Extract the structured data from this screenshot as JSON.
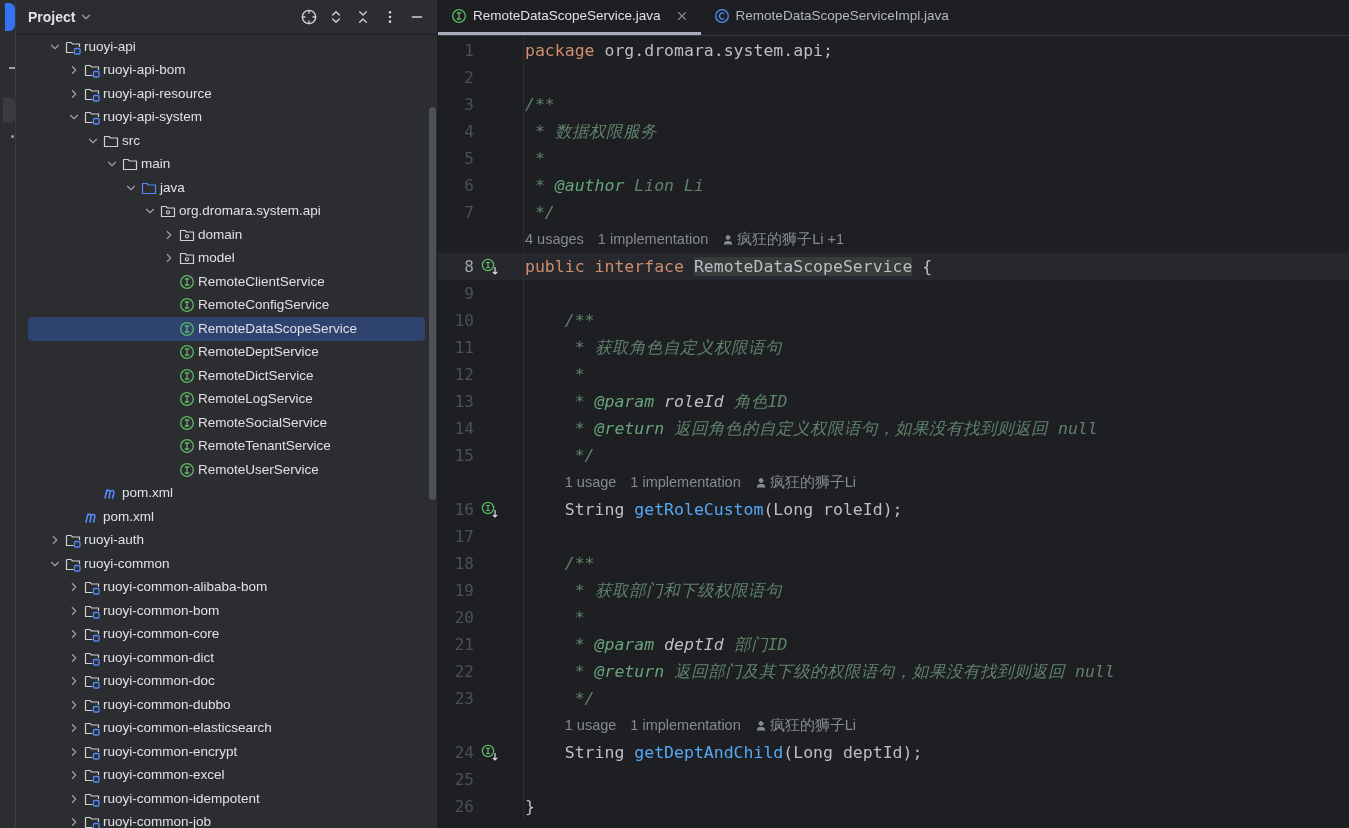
{
  "project_panel": {
    "title": "Project",
    "tree": [
      {
        "kind": "module",
        "label": "ruoyi-api",
        "expanded": true,
        "selected": false,
        "children": [
          {
            "kind": "module",
            "label": "ruoyi-api-bom",
            "expanded": false,
            "selected": false
          },
          {
            "kind": "module",
            "label": "ruoyi-api-resource",
            "expanded": false,
            "selected": false
          },
          {
            "kind": "module",
            "label": "ruoyi-api-system",
            "expanded": true,
            "selected": false,
            "children": [
              {
                "kind": "folder",
                "label": "src",
                "expanded": true,
                "selected": false,
                "children": [
                  {
                    "kind": "folder",
                    "label": "main",
                    "expanded": true,
                    "selected": false,
                    "children": [
                      {
                        "kind": "source",
                        "label": "java",
                        "expanded": true,
                        "selected": false,
                        "children": [
                          {
                            "kind": "package",
                            "label": "org.dromara.system.api",
                            "expanded": true,
                            "selected": false,
                            "children": [
                              {
                                "kind": "package",
                                "label": "domain",
                                "expanded": false,
                                "selected": false
                              },
                              {
                                "kind": "package",
                                "label": "model",
                                "expanded": false,
                                "selected": false
                              },
                              {
                                "kind": "interface",
                                "label": "RemoteClientService",
                                "selected": false
                              },
                              {
                                "kind": "interface",
                                "label": "RemoteConfigService",
                                "selected": false
                              },
                              {
                                "kind": "interface",
                                "label": "RemoteDataScopeService",
                                "selected": true
                              },
                              {
                                "kind": "interface",
                                "label": "RemoteDeptService",
                                "selected": false
                              },
                              {
                                "kind": "interface",
                                "label": "RemoteDictService",
                                "selected": false
                              },
                              {
                                "kind": "interface",
                                "label": "RemoteLogService",
                                "selected": false
                              },
                              {
                                "kind": "interface",
                                "label": "RemoteSocialService",
                                "selected": false
                              },
                              {
                                "kind": "interface",
                                "label": "RemoteTenantService",
                                "selected": false
                              },
                              {
                                "kind": "interface",
                                "label": "RemoteUserService",
                                "selected": false
                              }
                            ]
                          }
                        ]
                      }
                    ]
                  }
                ]
              },
              {
                "kind": "maven",
                "label": "pom.xml",
                "selected": false
              }
            ]
          },
          {
            "kind": "maven",
            "label": "pom.xml",
            "selected": false
          }
        ]
      },
      {
        "kind": "module",
        "label": "ruoyi-auth",
        "expanded": false,
        "selected": false
      },
      {
        "kind": "module",
        "label": "ruoyi-common",
        "expanded": true,
        "selected": false,
        "children": [
          {
            "kind": "module",
            "label": "ruoyi-common-alibaba-bom",
            "expanded": false,
            "selected": false
          },
          {
            "kind": "module",
            "label": "ruoyi-common-bom",
            "expanded": false,
            "selected": false
          },
          {
            "kind": "module",
            "label": "ruoyi-common-core",
            "expanded": false,
            "selected": false
          },
          {
            "kind": "module",
            "label": "ruoyi-common-dict",
            "expanded": false,
            "selected": false
          },
          {
            "kind": "module",
            "label": "ruoyi-common-doc",
            "expanded": false,
            "selected": false
          },
          {
            "kind": "module",
            "label": "ruoyi-common-dubbo",
            "expanded": false,
            "selected": false
          },
          {
            "kind": "module",
            "label": "ruoyi-common-elasticsearch",
            "expanded": false,
            "selected": false
          },
          {
            "kind": "module",
            "label": "ruoyi-common-encrypt",
            "expanded": false,
            "selected": false
          },
          {
            "kind": "module",
            "label": "ruoyi-common-excel",
            "expanded": false,
            "selected": false
          },
          {
            "kind": "module",
            "label": "ruoyi-common-idempotent",
            "expanded": false,
            "selected": false
          },
          {
            "kind": "module",
            "label": "ruoyi-common-job",
            "expanded": false,
            "selected": false
          }
        ]
      }
    ]
  },
  "editor": {
    "tabs": [
      {
        "kind": "interface",
        "label": "RemoteDataScopeService.java",
        "selected": true,
        "closable": true
      },
      {
        "kind": "class",
        "label": "RemoteDataScopeServiceImpl.java",
        "selected": false,
        "closable": false
      }
    ],
    "lines": [
      {
        "kind": "code",
        "number": "1",
        "current": false,
        "marker": false,
        "segments": [
          {
            "kind": "keyword",
            "text": "package "
          },
          {
            "kind": "plain",
            "text": "org.dromara.system.api;"
          }
        ]
      },
      {
        "kind": "code",
        "number": "2",
        "current": false,
        "marker": false
      },
      {
        "kind": "code",
        "number": "3",
        "current": false,
        "marker": false,
        "segments": [
          {
            "kind": "comment",
            "text": "/**"
          }
        ]
      },
      {
        "kind": "code",
        "number": "4",
        "current": false,
        "marker": false,
        "segments": [
          {
            "kind": "comment",
            "text": " * 数据权限服务"
          }
        ]
      },
      {
        "kind": "code",
        "number": "5",
        "current": false,
        "marker": false,
        "segments": [
          {
            "kind": "comment",
            "text": " *"
          }
        ]
      },
      {
        "kind": "code",
        "number": "6",
        "current": false,
        "marker": false,
        "segments": [
          {
            "kind": "comment",
            "text": " * "
          },
          {
            "kind": "tag",
            "text": "@author"
          },
          {
            "kind": "comment",
            "text": " Lion Li"
          }
        ]
      },
      {
        "kind": "code",
        "number": "7",
        "current": false,
        "marker": false,
        "segments": [
          {
            "kind": "comment",
            "text": " */"
          }
        ]
      },
      {
        "kind": "hint",
        "usages": "4 usages",
        "implementations": "1 implementation",
        "author": "疯狂的狮子Li +1"
      },
      {
        "kind": "code",
        "number": "8",
        "current": true,
        "marker": true,
        "segments": [
          {
            "kind": "keyword",
            "text": "public interface "
          },
          {
            "kind": "ref",
            "text": "RemoteDataScopeService"
          },
          {
            "kind": "plain",
            "text": " {"
          }
        ]
      },
      {
        "kind": "code",
        "number": "9",
        "current": false,
        "marker": false
      },
      {
        "kind": "code",
        "number": "10",
        "current": false,
        "marker": false,
        "segments": [
          {
            "kind": "comment",
            "text": "    /**"
          }
        ]
      },
      {
        "kind": "code",
        "number": "11",
        "current": false,
        "marker": false,
        "segments": [
          {
            "kind": "comment",
            "text": "     * 获取角色自定义权限语句"
          }
        ]
      },
      {
        "kind": "code",
        "number": "12",
        "current": false,
        "marker": false,
        "segments": [
          {
            "kind": "comment",
            "text": "     *"
          }
        ]
      },
      {
        "kind": "code",
        "number": "13",
        "current": false,
        "marker": false,
        "segments": [
          {
            "kind": "comment",
            "text": "     * "
          },
          {
            "kind": "tag",
            "text": "@param"
          },
          {
            "kind": "param",
            "text": " roleId"
          },
          {
            "kind": "comment",
            "text": " 角色ID"
          }
        ]
      },
      {
        "kind": "code",
        "number": "14",
        "current": false,
        "marker": false,
        "segments": [
          {
            "kind": "comment",
            "text": "     * "
          },
          {
            "kind": "tag",
            "text": "@return"
          },
          {
            "kind": "comment",
            "text": " 返回角色的自定义权限语句，如果没有找到则返回 null"
          }
        ]
      },
      {
        "kind": "code",
        "number": "15",
        "current": false,
        "marker": false,
        "segments": [
          {
            "kind": "comment",
            "text": "     */"
          }
        ]
      },
      {
        "kind": "hint",
        "usages": "1 usage",
        "implementations": "1 implementation",
        "author": "疯狂的狮子Li"
      },
      {
        "kind": "code",
        "number": "16",
        "current": false,
        "marker": true,
        "segments": [
          {
            "kind": "plain",
            "text": "    String "
          },
          {
            "kind": "method",
            "text": "getRoleCustom"
          },
          {
            "kind": "plain",
            "text": "(Long roleId);"
          }
        ]
      },
      {
        "kind": "code",
        "number": "17",
        "current": false,
        "marker": false
      },
      {
        "kind": "code",
        "number": "18",
        "current": false,
        "marker": false,
        "segments": [
          {
            "kind": "comment",
            "text": "    /**"
          }
        ]
      },
      {
        "kind": "code",
        "number": "19",
        "current": false,
        "marker": false,
        "segments": [
          {
            "kind": "comment",
            "text": "     * 获取部门和下级权限语句"
          }
        ]
      },
      {
        "kind": "code",
        "number": "20",
        "current": false,
        "marker": false,
        "segments": [
          {
            "kind": "comment",
            "text": "     *"
          }
        ]
      },
      {
        "kind": "code",
        "number": "21",
        "current": false,
        "marker": false,
        "segments": [
          {
            "kind": "comment",
            "text": "     * "
          },
          {
            "kind": "tag",
            "text": "@param"
          },
          {
            "kind": "param",
            "text": " deptId"
          },
          {
            "kind": "comment",
            "text": " 部门ID"
          }
        ]
      },
      {
        "kind": "code",
        "number": "22",
        "current": false,
        "marker": false,
        "segments": [
          {
            "kind": "comment",
            "text": "     * "
          },
          {
            "kind": "tag",
            "text": "@return"
          },
          {
            "kind": "comment",
            "text": " 返回部门及其下级的权限语句，如果没有找到则返回 null"
          }
        ]
      },
      {
        "kind": "code",
        "number": "23",
        "current": false,
        "marker": false,
        "segments": [
          {
            "kind": "comment",
            "text": "     */"
          }
        ]
      },
      {
        "kind": "hint",
        "usages": "1 usage",
        "implementations": "1 implementation",
        "author": "疯狂的狮子Li"
      },
      {
        "kind": "code",
        "number": "24",
        "current": false,
        "marker": true,
        "segments": [
          {
            "kind": "plain",
            "text": "    String "
          },
          {
            "kind": "method",
            "text": "getDeptAndChild"
          },
          {
            "kind": "plain",
            "text": "(Long deptId);"
          }
        ]
      },
      {
        "kind": "code",
        "number": "25",
        "current": false,
        "marker": false
      },
      {
        "kind": "code",
        "number": "26",
        "current": false,
        "marker": false,
        "segments": [
          {
            "kind": "plain",
            "text": "}"
          }
        ]
      }
    ]
  }
}
